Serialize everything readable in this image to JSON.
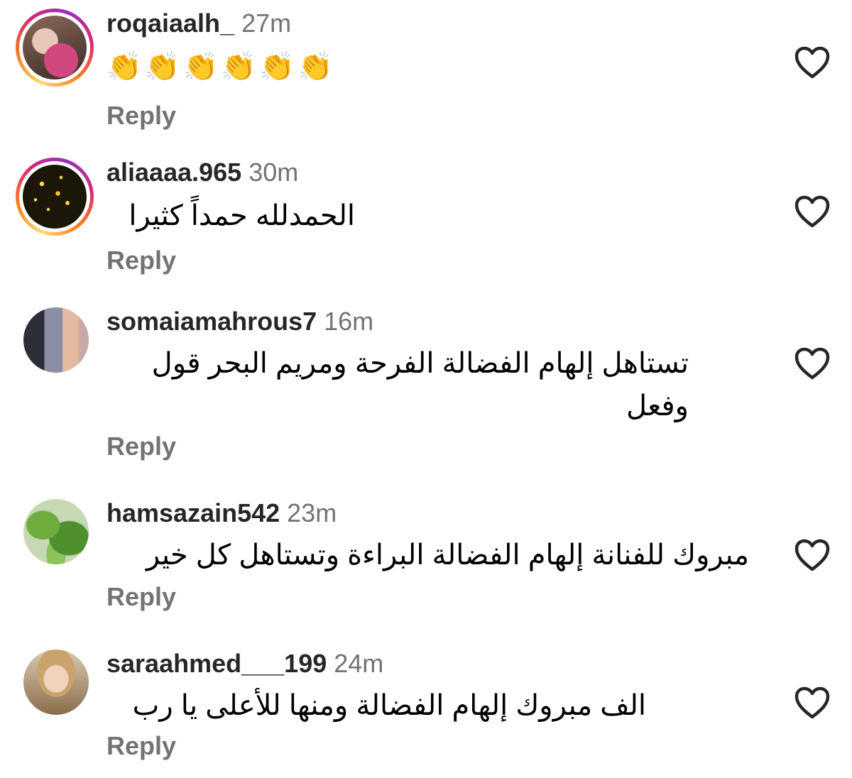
{
  "comments": [
    {
      "username": "roqaiaalh_",
      "time": "27m",
      "text": "👏👏👏👏👏👏",
      "reply_label": "Reply",
      "has_story": true
    },
    {
      "username": "aliaaaa.965",
      "time": "30m",
      "text": "الحمدلله حمداً كثيرا",
      "reply_label": "Reply",
      "has_story": true
    },
    {
      "username": "somaiamahrous7",
      "time": "16m",
      "text": "تستاهل إلهام الفضالة الفرحة ومريم البحر قول وفعل",
      "reply_label": "Reply",
      "has_story": false
    },
    {
      "username": "hamsazain542",
      "time": "23m",
      "text": "مبروك للفنانة إلهام الفضالة البراءة وتستاهل كل خير",
      "reply_label": "Reply",
      "has_story": false
    },
    {
      "username": "saraahmed___199",
      "time": "24m",
      "text": "الف مبروك إلهام الفضالة ومنها للأعلى يا رب",
      "reply_label": "Reply",
      "has_story": false
    }
  ],
  "icons": {
    "like": "heart-outline-icon"
  },
  "colors": {
    "username": "#262626",
    "secondary": "#737373",
    "text": "#000000"
  }
}
